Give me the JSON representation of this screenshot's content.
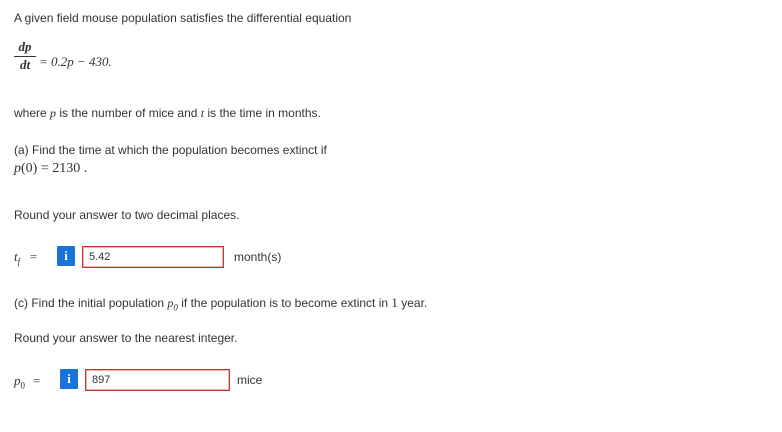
{
  "intro": "A given field mouse population satisfies the differential equation",
  "equation": {
    "numerator": "dp",
    "denominator": "dt",
    "rhs": "= 0.2p − 430."
  },
  "where_text": {
    "pre": "where ",
    "p": "p",
    "mid": " is the number of mice and ",
    "t": "t",
    "post": " is the time in months."
  },
  "part_a": {
    "question": "(a) Find the time at which the population becomes extinct if",
    "condition_p": "p",
    "condition_rest": "(0)  = 2130  .",
    "rounding": "Round your answer to two decimal places.",
    "var_t": "t",
    "var_sub": "f",
    "equals": "=",
    "info_label": "i",
    "answer": "5.42",
    "unit": "month(s)"
  },
  "part_c": {
    "question_pre": "(c) Find the initial population ",
    "p0_p": "p",
    "p0_sub": "0",
    "question_mid": " if the population is to become extinct in ",
    "one": "1",
    "question_post": " year.",
    "rounding": "Round your answer to the nearest integer.",
    "var_label": "p",
    "var_sub": "0",
    "equals": "=",
    "info_label": "i",
    "answer": "897",
    "unit": "mice"
  },
  "colors": {
    "info_button": "#1a73d9",
    "answer_border": "#c0392b",
    "text": "#333333"
  }
}
